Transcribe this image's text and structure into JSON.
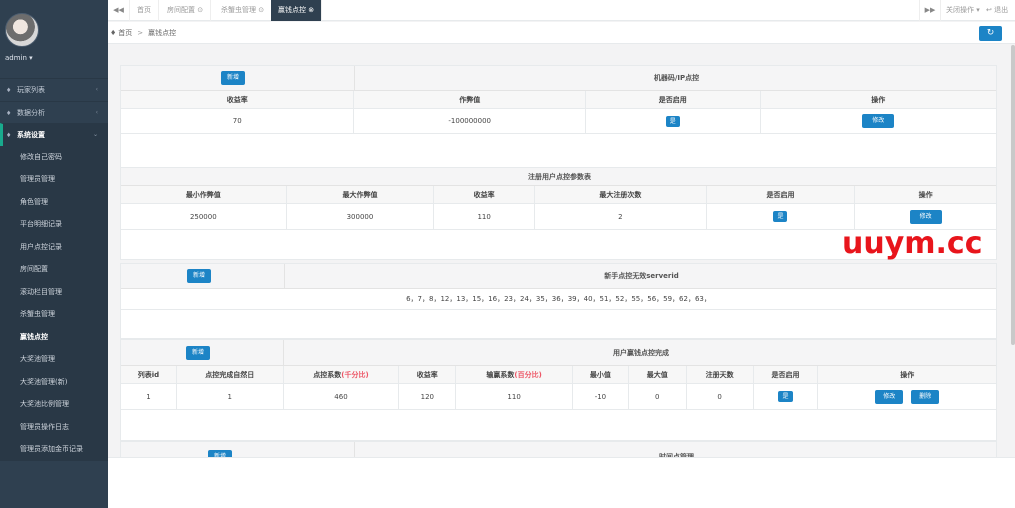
{
  "sidebar": {
    "user": "admin ▾",
    "menu": [
      {
        "label": "玩家列表",
        "icon": "home-icon"
      },
      {
        "label": "数据分析",
        "icon": "home-icon"
      },
      {
        "label": "系统设置",
        "icon": "home-icon"
      }
    ],
    "submenu": [
      "修改自己密码",
      "管理员管理",
      "角色管理",
      "平台明细记录",
      "用户点控记录",
      "房间配置",
      "滚动栏目管理",
      "杀蟹虫管理",
      "赢钱点控",
      "大奖池管理",
      "大奖池管理(新)",
      "大奖池比例管理",
      "管理员操作日志",
      "管理员添加金币记录"
    ]
  },
  "tabs": [
    {
      "label": "首页"
    },
    {
      "label": "房间配置 ⊙"
    },
    {
      "label": "杀蟹虫管理 ⊙"
    },
    {
      "label": "赢钱点控 ⊗"
    }
  ],
  "topbar": {
    "close_ops": "关闭操作 ▾",
    "logout": "退出"
  },
  "breadcrumb": {
    "home": "首页",
    "sep": ">",
    "current": "赢钱点控"
  },
  "section1": {
    "add": "新增",
    "title": "机器码/IP点控",
    "headers": [
      "收益率",
      "作弊值",
      "是否启用",
      "操作"
    ],
    "row": {
      "rate": "70",
      "cheat": "-100000000",
      "enabled": "是",
      "action": "修改"
    }
  },
  "section2": {
    "title": "注册用户点控参数表",
    "headers": [
      "最小作弊值",
      "最大作弊值",
      "收益率",
      "最大注册次数",
      "是否启用",
      "操作"
    ],
    "row": {
      "min": "250000",
      "max": "300000",
      "rate": "110",
      "reg": "2",
      "enabled": "是",
      "action": "修改"
    }
  },
  "section3": {
    "add": "新增",
    "title": "新手点控无效serverid",
    "ids": "6，7，8，12，13，15，16，23，24，35，36，39，40，51，52，55，56，59，62，63，"
  },
  "section4": {
    "add": "新增",
    "title": "用户赢钱点控完成",
    "headers": [
      "列表id",
      "点控完成自然日",
      "点控系数",
      "(千分比)",
      "收益率",
      "输赢系数",
      "(百分比)",
      "最小值",
      "最大值",
      "注册天数",
      "是否启用",
      "操作"
    ],
    "row": {
      "id": "1",
      "day": "1",
      "coef": "460",
      "rate": "120",
      "wl": "110",
      "min": "-10",
      "max": "0",
      "days": "0",
      "enabled": "是",
      "edit": "修改",
      "del": "删除"
    }
  },
  "section5": {
    "add": "新增",
    "title": "时间点管理"
  },
  "watermark": "uuym.cc",
  "colors": {
    "sidebar": "#2f4050",
    "primary": "#1c84c6",
    "watermark": "#e8151c"
  }
}
